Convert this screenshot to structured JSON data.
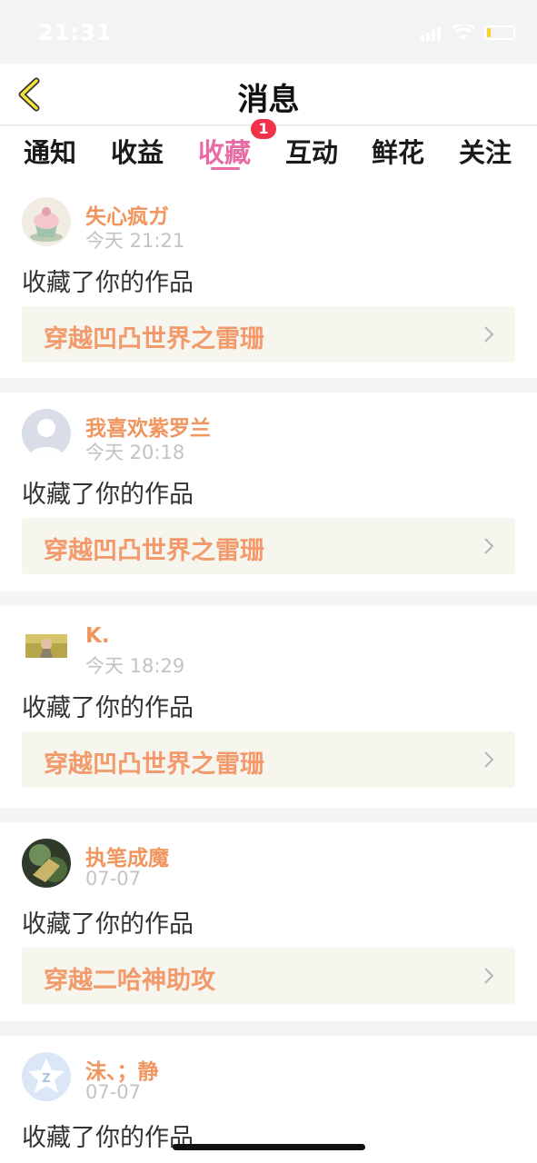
{
  "status_bar": {
    "time": "21:31",
    "battery_color": "#ffd21f"
  },
  "nav": {
    "back_icon": "chevron-left-icon",
    "title": "消息"
  },
  "tabs": [
    {
      "label": "通知",
      "active": false
    },
    {
      "label": "收益",
      "active": false
    },
    {
      "label": "收藏",
      "active": true,
      "badge": "1"
    },
    {
      "label": "互动",
      "active": false
    },
    {
      "label": "鲜花",
      "active": false
    },
    {
      "label": "关注",
      "active": false
    }
  ],
  "colors": {
    "accent": "#e86ba3",
    "name": "#f0955d",
    "work": "#f29a6b",
    "badge": "#f0334b",
    "work_bg": "#f6f5ee"
  },
  "notifications": [
    {
      "user": "失心疯ガ",
      "time": "今天 21:21",
      "action": "收藏了你的作品",
      "work": "穿越凹凸世界之雷珊",
      "avatar": "cupcake-avatar"
    },
    {
      "user": "我喜欢紫罗兰",
      "time": "今天 20:18",
      "action": "收藏了你的作品",
      "work": "穿越凹凸世界之雷珊",
      "avatar": "default-avatar"
    },
    {
      "user": "K.",
      "time": "今天 18:29",
      "action": "收藏了你的作品",
      "work": "穿越凹凸世界之雷珊",
      "avatar": "photo-avatar"
    },
    {
      "user": "执笔成魔",
      "time": "07-07",
      "action": "收藏了你的作品",
      "work": "穿越二哈神助攻",
      "avatar": "illustration-avatar"
    },
    {
      "user": "沫、；静",
      "time": "07-07",
      "action": "收藏了你的作品",
      "work": "",
      "avatar": "qq-avatar"
    }
  ]
}
